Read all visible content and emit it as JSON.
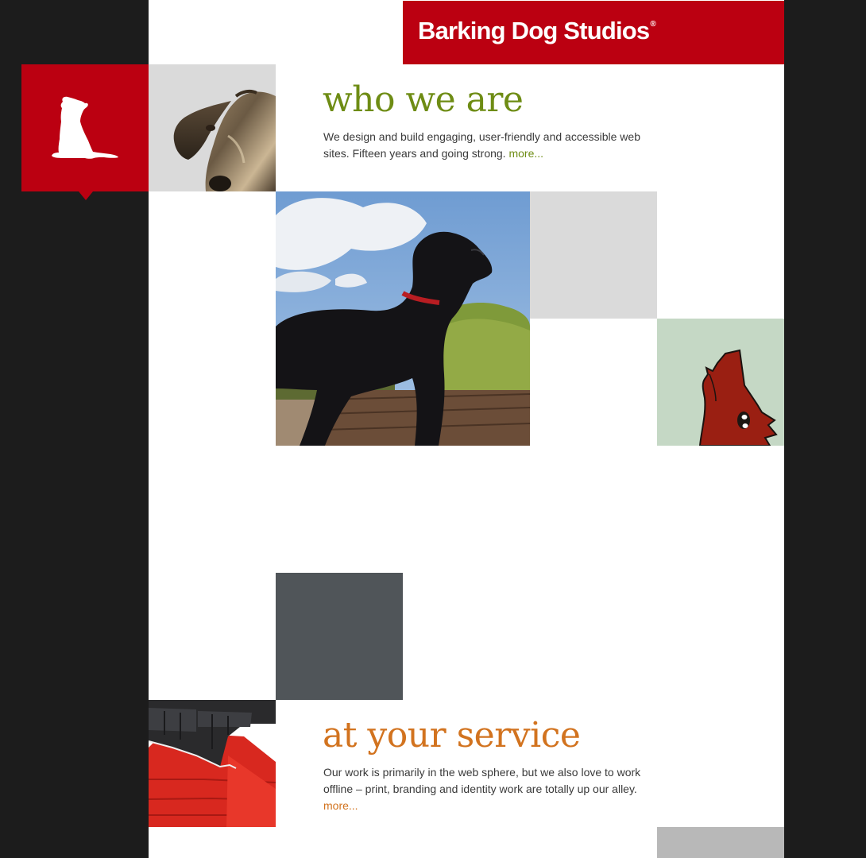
{
  "header": {
    "brand": "Barking Dog Studios",
    "registered_mark": "®"
  },
  "logo": {
    "icon": "sitting-dog-silhouette-icon"
  },
  "sections": [
    {
      "title": "who we are",
      "text": "We design and build engaging, user-friendly and accessible web sites. Fifteen years and going strong.",
      "more_label": "more...",
      "color": "#6e8c14"
    },
    {
      "title": "at your service",
      "text": "Our work is primarily in the web sphere, but we also love to work offline – print, branding and identity work are totally up our alley.",
      "more_label": "more...",
      "color": "#d2731f"
    }
  ],
  "images": {
    "statue_dog": "bronze-dog-statue-photo",
    "black_dog": "black-dog-photo",
    "red_dog_art": "red-dog-painting",
    "doghouse": "red-doghouse-photo"
  },
  "colors": {
    "brand_red": "#bb0011",
    "light_gray": "#dadada",
    "sage": "#c5d8c5",
    "slate": "#505559",
    "background": "#1c1c1c"
  }
}
